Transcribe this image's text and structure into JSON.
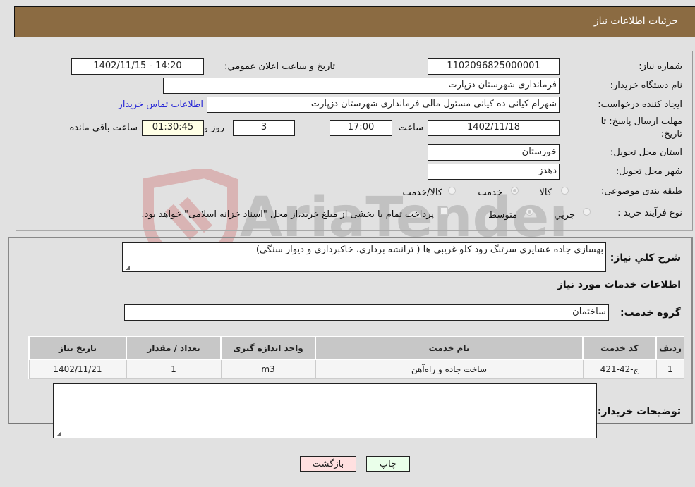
{
  "header": {
    "title": "جزئیات اطلاعات نیاز"
  },
  "form": {
    "need_number_label": "شماره نیاز:",
    "need_number": "1102096825000001",
    "announce_label": "تاریخ و ساعت اعلان عمومي:",
    "announce_value": "1402/11/15 - 14:20",
    "buyer_org_label": "نام دستگاه خریدار:",
    "buyer_org": "فرمانداری شهرستان دزپارت",
    "requester_label": "ایجاد کننده درخواست:",
    "requester": "شهرام کیانی ده کیانی مسئول مالی فرمانداری شهرستان دزپارت",
    "contact_link": "اطلاعات تماس خریدار",
    "deadline_label_line1": "مهلت ارسال پاسخ: تا",
    "deadline_label_line2": "تاریخ:",
    "deadline_date": "1402/11/18",
    "time_label": "ساعت",
    "deadline_time": "17:00",
    "days_value": "3",
    "days_label": "روز و",
    "remaining_value": "01:30:45",
    "remaining_label": "ساعت باقي مانده",
    "province_label": "استان محل تحویل:",
    "province": "خوزستان",
    "city_label": "شهر محل تحویل:",
    "city": "دهدز",
    "category_label": "طبقه بندی موضوعی:",
    "category_options": [
      {
        "label": "کالا",
        "checked": false
      },
      {
        "label": "خدمت",
        "checked": true
      },
      {
        "label": "کالا/خدمت",
        "checked": false
      }
    ],
    "process_label": "نوع فرآیند خرید :",
    "process_options": [
      {
        "label": "جزیي",
        "checked": false
      },
      {
        "label": "متوسط",
        "checked": true
      }
    ],
    "treasury_note": "پرداخت تمام یا بخشی از مبلغ خرید،از محل \"اسناد خزانه اسلامی\" خواهد بود.",
    "treasury_checked": false
  },
  "details": {
    "description_label": "شرح کلي نیاز:",
    "description": "بهسازی جاده عشایری سرتنگ رود کلو غریبی ها ( ترانشه برداری، خاکبرداری و دیوار سنگی)",
    "services_heading": "اطلاعات خدمات مورد نیاز",
    "service_group_label": "گروه خدمت:",
    "service_group": "ساختمان",
    "table": {
      "headers": [
        "ردیف",
        "کد خدمت",
        "نام خدمت",
        "واحد اندازه گیری",
        "تعداد / مقدار",
        "تاریخ نیاز"
      ],
      "rows": [
        [
          "1",
          "ج-42-421",
          "ساخت جاده و راه‌آهن",
          "m3",
          "1",
          "1402/11/21"
        ]
      ]
    },
    "buyer_notes_label": "توضیحات خریدار:",
    "buyer_notes": ""
  },
  "buttons": {
    "print": "چاپ",
    "back": "بازگشت"
  },
  "colors": {
    "header_bg": "#8b6b42",
    "print_bg": "#eaffea",
    "back_bg": "#ffe0e0",
    "link": "#2a2ad6"
  },
  "watermark": {
    "text": "AriaTender.neT"
  }
}
